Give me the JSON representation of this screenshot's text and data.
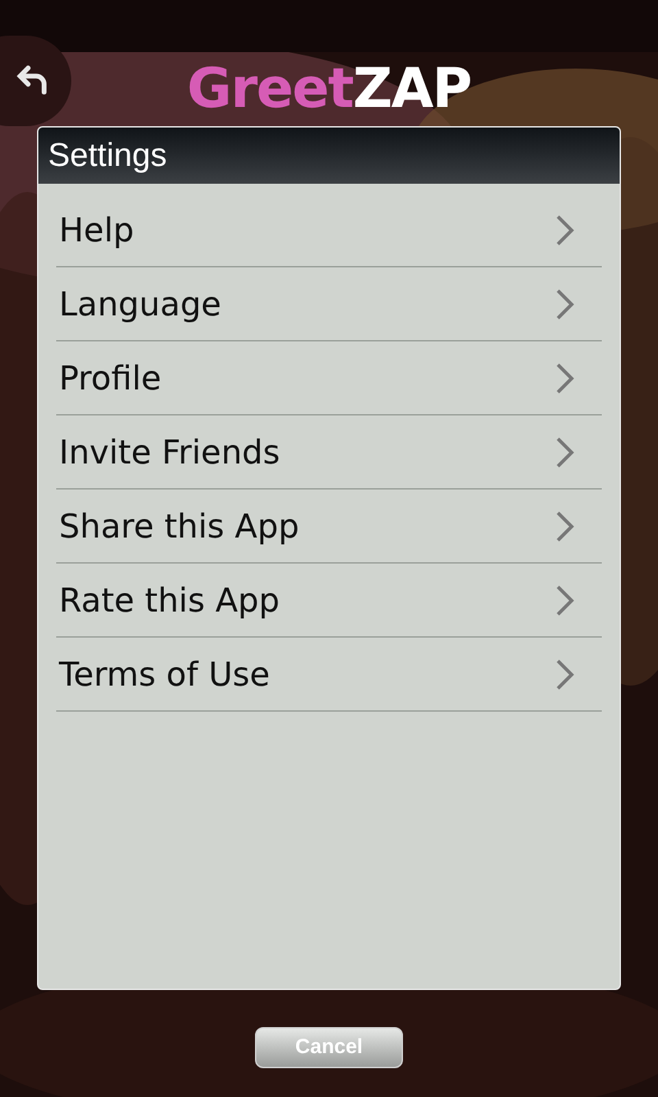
{
  "header": {
    "logo": {
      "first": "Greet",
      "second": "ZAP"
    }
  },
  "settings": {
    "title": "Settings",
    "items": [
      {
        "label": "Help"
      },
      {
        "label": "Language"
      },
      {
        "label": "Profile"
      },
      {
        "label": "Invite Friends"
      },
      {
        "label": "Share this App"
      },
      {
        "label": "Rate this App"
      },
      {
        "label": "Terms of Use"
      }
    ]
  },
  "buttons": {
    "cancel": "Cancel"
  }
}
